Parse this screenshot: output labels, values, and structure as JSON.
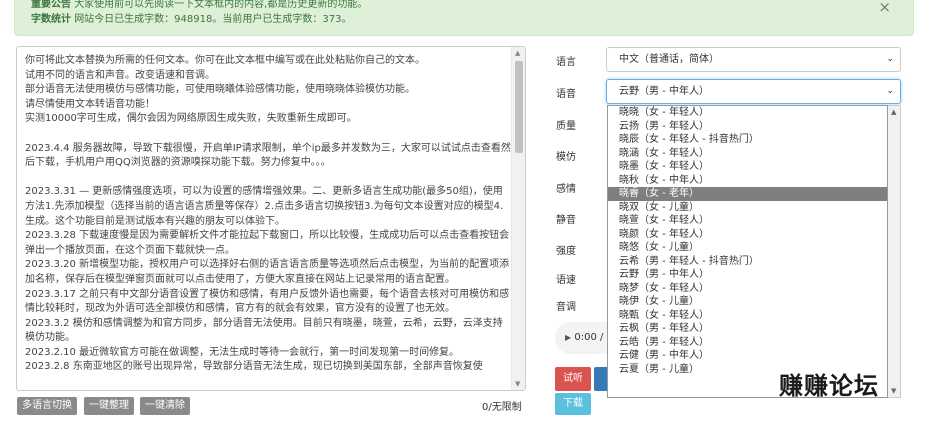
{
  "notice": {
    "line1_bold": "重要公告",
    "line1_text": "大家使用前可以先阅读一下文本框内的内容,都是历史更新的功能。",
    "line2_bold": "字数统计",
    "line2_text": "网站今日已生成字数：948918。当前用户已生成字数：373。",
    "close": "×"
  },
  "editor": {
    "text": "你可将此文本替换为所需的任何文本。你可在此文本框中编写或在此处粘贴你自己的文本。\n试用不同的语言和声音。改变语速和音调。\n部分语音无法使用模仿与感情功能，可使用晓曦体验感情功能，使用晓晓体验模仿功能。\n请尽情使用文本转语音功能！\n实测10000字可生成，偶尔会因为网络原因生成失败，失败重新生成即可。\n\n2023.4.4 服务器故障，导致下载很慢，开启单IP请求限制，单个ip最多并发数为三，大家可以试试点击查看然后下载，手机用户用QQ浏览器的资源嗅探功能下载。努力修复中。。。\n\n2023.3.31 — 更新感情强度选项，可以为设置的感情增强效果。二、更新多语言生成功能(最多50组)，使用方法1.先添加模型（选择当前的语言语言质量等保存）2.点击多语言切换按钮3.为每句文本设置对应的模型4.生成。这个功能目前是测试版本有兴趣的朋友可以体验下。\n2023.3.28 下载速度慢是因为需要解析文件才能拉起下载窗口，所以比较慢，生成成功后可以点击查看按钮会弹出一个播放页面，在这个页面下载就快一点。\n2023.3.20 新增模型功能，授权用户可以选择好右侧的语言语言质量等选项然后点击模型，为当前的配置项添加名称，保存后在模型弹窗页面就可以点击使用了，方便大家直接在网站上记录常用的语言配置。\n2023.3.17 之前只有中文部分语音设置了模仿和感情，有用户反馈外语也需要，每个语音去核对可用模仿和感情比较耗时，现改为外语可选全部模仿和感情，官方有的就会有效果，官方没有的设置了也无效。\n2023.3.2 模仿和感情调整为和官方同步，部分语音无法使用。目前只有晓墨，晓萱，云希，云野，云泽支持模仿功能。\n2023.2.10 最近微软官方可能在做调整，无法生成时等待一会就行，第一时间发现第一时间修复。\n2023.2.8 东南亚地区的账号出现异常，导致部分语音无法生成，现已切换到美国东部，全部声音恢复使"
  },
  "buttons": {
    "multi_lang": "多语言切换",
    "tidy": "一键整理",
    "clear": "一键清除",
    "listen": "试听",
    "download": "下载"
  },
  "counter": "0/无限制",
  "labels": {
    "language": "语言",
    "voice": "语音",
    "quality": "质量",
    "mimic": "模仿",
    "emotion": "感情",
    "silence": "静音",
    "intensity": "强度",
    "speed": "语速",
    "pitch": "音调"
  },
  "language_select": {
    "value": "中文（普通话，简体）"
  },
  "voice_select": {
    "value": "云野（男 - 中年人）"
  },
  "voice_options": [
    "晓晓（女 - 年轻人）",
    "云扬（男 - 年轻人）",
    "晓辰（女 - 年轻人 - 抖音热门）",
    "晓涵（女 - 年轻人）",
    "晓墨（女 - 年轻人）",
    "晓秋（女 - 中年人）",
    "晓睿（女 - 老年）",
    "晓双（女 - 儿童）",
    "晓萱（女 - 年轻人）",
    "晓颜（女 - 年轻人）",
    "晓悠（女 - 儿童）",
    "云希（男 - 年轻人 - 抖音热门）",
    "云野（男 - 中年人）",
    "晓梦（女 - 年轻人）",
    "晓伊（女 - 儿童）",
    "晓甄（女 - 年轻人）",
    "云枫（男 - 年轻人）",
    "云皓（男 - 年轻人）",
    "云健（男 - 中年人）",
    "云夏（男 - 儿童）"
  ],
  "selected_voice_option_index": 6,
  "audio": {
    "time": "0:00 /"
  },
  "watermark": "赚赚论坛"
}
